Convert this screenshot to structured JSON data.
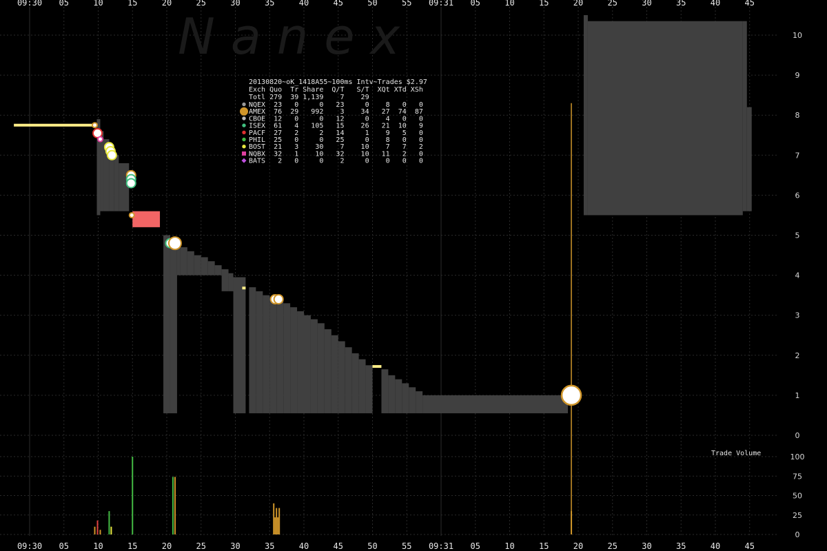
{
  "watermark": "N  a  n  e  x",
  "colors": {
    "background": "#000000",
    "grid": "#2b2b2b",
    "bid_ask_fill": "#404040",
    "nbbo_highlight": "#f26565",
    "quote_line": "#ffee88",
    "trade_spike": "#d0962a",
    "volume_amex": "#d0962a"
  },
  "chart_data": {
    "type": "line",
    "title": "20130820~oK_1418A55~100ms Intv~Trades $2.97",
    "x_axis": {
      "tick_labels": [
        "09:30",
        "05",
        "10",
        "15",
        "20",
        "25",
        "30",
        "35",
        "40",
        "45",
        "50",
        "55",
        "09:31",
        "05",
        "10",
        "15",
        "20",
        "25",
        "30",
        "35",
        "40",
        "45"
      ],
      "tick_seconds": [
        0,
        5,
        10,
        15,
        20,
        25,
        30,
        35,
        40,
        45,
        50,
        55,
        60,
        65,
        70,
        75,
        80,
        85,
        90,
        95,
        100,
        105
      ]
    },
    "price_axis": {
      "ticks": [
        0,
        1,
        2,
        3,
        4,
        5,
        6,
        7,
        8,
        9,
        10
      ],
      "range": [
        -0.45,
        11
      ]
    },
    "volume_axis": {
      "title": "Trade Volume",
      "ticks": [
        0,
        25,
        50,
        75,
        100
      ],
      "range": [
        0,
        100
      ]
    },
    "grid": true,
    "bid_ask_spread": [
      {
        "t0": 9.8,
        "t1": 10.3,
        "low": 5.5,
        "high": 7.9
      },
      {
        "t0": 10.3,
        "t1": 10.8,
        "low": 5.6,
        "high": 7.6
      },
      {
        "t0": 10.8,
        "t1": 11.6,
        "low": 5.6,
        "high": 7.4
      },
      {
        "t0": 11.6,
        "t1": 12.3,
        "low": 5.6,
        "high": 7.2
      },
      {
        "t0": 12.3,
        "t1": 13.0,
        "low": 5.6,
        "high": 7.0
      },
      {
        "t0": 13.0,
        "t1": 14.5,
        "low": 5.6,
        "high": 6.8
      },
      {
        "t0": 19.5,
        "t1": 20.5,
        "low": 0.55,
        "high": 5.0
      },
      {
        "t0": 20.5,
        "t1": 21.5,
        "low": 0.55,
        "high": 4.85
      },
      {
        "t0": 21.5,
        "t1": 22.0,
        "low": 4.0,
        "high": 4.8
      },
      {
        "t0": 22.0,
        "t1": 23.0,
        "low": 4.0,
        "high": 4.7
      },
      {
        "t0": 23.0,
        "t1": 24.0,
        "low": 4.0,
        "high": 4.6
      },
      {
        "t0": 24.0,
        "t1": 25.0,
        "low": 4.0,
        "high": 4.5
      },
      {
        "t0": 25.0,
        "t1": 26.0,
        "low": 4.0,
        "high": 4.45
      },
      {
        "t0": 26.0,
        "t1": 27.0,
        "low": 4.0,
        "high": 4.35
      },
      {
        "t0": 27.0,
        "t1": 28.0,
        "low": 4.0,
        "high": 4.25
      },
      {
        "t0": 28.0,
        "t1": 29.0,
        "low": 3.6,
        "high": 4.15
      },
      {
        "t0": 29.0,
        "t1": 29.7,
        "low": 3.6,
        "high": 4.05
      },
      {
        "t0": 29.7,
        "t1": 31.5,
        "low": 0.55,
        "high": 3.95
      },
      {
        "t0": 32.0,
        "t1": 33.0,
        "low": 0.55,
        "high": 3.7
      },
      {
        "t0": 33.0,
        "t1": 34.0,
        "low": 0.55,
        "high": 3.6
      },
      {
        "t0": 34.0,
        "t1": 35.0,
        "low": 0.55,
        "high": 3.5
      },
      {
        "t0": 35.0,
        "t1": 36.0,
        "low": 0.55,
        "high": 3.45
      },
      {
        "t0": 36.0,
        "t1": 37.0,
        "low": 0.55,
        "high": 3.4
      },
      {
        "t0": 37.0,
        "t1": 38.0,
        "low": 0.55,
        "high": 3.3
      },
      {
        "t0": 38.0,
        "t1": 39.0,
        "low": 0.55,
        "high": 3.2
      },
      {
        "t0": 39.0,
        "t1": 40.0,
        "low": 0.55,
        "high": 3.1
      },
      {
        "t0": 40.0,
        "t1": 41.0,
        "low": 0.55,
        "high": 3.0
      },
      {
        "t0": 41.0,
        "t1": 42.0,
        "low": 0.55,
        "high": 2.9
      },
      {
        "t0": 42.0,
        "t1": 43.0,
        "low": 0.55,
        "high": 2.8
      },
      {
        "t0": 43.0,
        "t1": 44.0,
        "low": 0.55,
        "high": 2.65
      },
      {
        "t0": 44.0,
        "t1": 45.0,
        "low": 0.55,
        "high": 2.5
      },
      {
        "t0": 45.0,
        "t1": 46.0,
        "low": 0.55,
        "high": 2.35
      },
      {
        "t0": 46.0,
        "t1": 47.0,
        "low": 0.55,
        "high": 2.2
      },
      {
        "t0": 47.0,
        "t1": 48.0,
        "low": 0.55,
        "high": 2.05
      },
      {
        "t0": 48.0,
        "t1": 49.0,
        "low": 0.55,
        "high": 1.9
      },
      {
        "t0": 49.0,
        "t1": 50.0,
        "low": 0.55,
        "high": 1.75
      },
      {
        "t0": 51.3,
        "t1": 52.3,
        "low": 0.55,
        "high": 1.65
      },
      {
        "t0": 52.3,
        "t1": 53.3,
        "low": 0.55,
        "high": 1.5
      },
      {
        "t0": 53.3,
        "t1": 54.3,
        "low": 0.55,
        "high": 1.4
      },
      {
        "t0": 54.3,
        "t1": 55.3,
        "low": 0.55,
        "high": 1.3
      },
      {
        "t0": 55.3,
        "t1": 56.3,
        "low": 0.55,
        "high": 1.2
      },
      {
        "t0": 56.3,
        "t1": 57.3,
        "low": 0.55,
        "high": 1.1
      },
      {
        "t0": 57.3,
        "t1": 78.5,
        "low": 0.55,
        "high": 1.0
      },
      {
        "t0": 80.8,
        "t1": 81.4,
        "low": 5.5,
        "high": 10.5
      },
      {
        "t0": 81.4,
        "t1": 104.0,
        "low": 5.5,
        "high": 10.35
      },
      {
        "t0": 104.0,
        "t1": 104.6,
        "low": 5.6,
        "high": 10.35
      },
      {
        "t0": 104.6,
        "t1": 105.3,
        "low": 5.6,
        "high": 8.2
      }
    ],
    "nbbo_highlight": [
      {
        "t0": 15.0,
        "t1": 19.0,
        "low": 5.2,
        "high": 5.6
      }
    ],
    "quote_segments": [
      {
        "t0": -2.3,
        "t1": 9.6,
        "price": 7.75
      },
      {
        "t0": 31.0,
        "t1": 31.5,
        "price": 3.68
      },
      {
        "t0": 50.0,
        "t1": 51.3,
        "price": 1.72
      }
    ],
    "trade_spike": {
      "t": 79.0,
      "low": 0.0,
      "high": 8.3
    },
    "trades": [
      {
        "t": 9.5,
        "price": 7.75,
        "size": "s",
        "exchange": "AMEX"
      },
      {
        "t": 9.9,
        "price": 7.55,
        "size": "m",
        "exchange": "PACF"
      },
      {
        "t": 10.3,
        "price": 7.4,
        "size": "s",
        "exchange": "NQBX"
      },
      {
        "t": 11.6,
        "price": 7.2,
        "size": "m",
        "exchange": "BOST"
      },
      {
        "t": 11.8,
        "price": 7.1,
        "size": "m",
        "exchange": "BOST"
      },
      {
        "t": 12.0,
        "price": 7.0,
        "size": "m",
        "exchange": "BOST"
      },
      {
        "t": 14.8,
        "price": 6.5,
        "size": "m",
        "exchange": "AMEX"
      },
      {
        "t": 14.8,
        "price": 6.4,
        "size": "m",
        "exchange": "ISEX"
      },
      {
        "t": 14.8,
        "price": 6.3,
        "size": "m",
        "exchange": "ISEX"
      },
      {
        "t": 14.9,
        "price": 5.5,
        "size": "s",
        "exchange": "AMEX"
      },
      {
        "t": 20.5,
        "price": 4.8,
        "size": "m",
        "exchange": "ISEX"
      },
      {
        "t": 21.2,
        "price": 4.8,
        "size": "l",
        "exchange": "AMEX"
      },
      {
        "t": 35.8,
        "price": 3.4,
        "size": "m",
        "exchange": "AMEX"
      },
      {
        "t": 36.3,
        "price": 3.4,
        "size": "m",
        "exchange": "AMEX"
      },
      {
        "t": 79.0,
        "price": 1.0,
        "size": "xl",
        "exchange": "AMEX"
      }
    ],
    "volume_bars": [
      {
        "t": 9.5,
        "value": 10,
        "color": "#d0962a"
      },
      {
        "t": 9.9,
        "value": 18,
        "color": "#e04040"
      },
      {
        "t": 10.3,
        "value": 6,
        "color": "#d0962a"
      },
      {
        "t": 11.6,
        "value": 30,
        "color": "#44bb44"
      },
      {
        "t": 11.9,
        "value": 10,
        "color": "#e8e840"
      },
      {
        "t": 15.0,
        "value": 100,
        "color": "#44bb44"
      },
      {
        "t": 20.9,
        "value": 74,
        "color": "#44bb44"
      },
      {
        "t": 21.2,
        "value": 74,
        "color": "#d0962a"
      },
      {
        "t": 35.6,
        "value": 40,
        "color": "#d0962a"
      },
      {
        "t": 35.8,
        "value": 22,
        "color": "#d0962a"
      },
      {
        "t": 36.0,
        "value": 34,
        "color": "#d0962a"
      },
      {
        "t": 36.2,
        "value": 22,
        "color": "#d0962a"
      },
      {
        "t": 36.4,
        "value": 34,
        "color": "#d0962a"
      },
      {
        "t": 79.0,
        "value": 30,
        "color": "#d0962a"
      }
    ],
    "legend_table": {
      "header": "Exch Quo  Tr Share  Q/T   S/T  XQt XTd XSh",
      "totals": "Totl 279  39 1,139    7    29",
      "rows": [
        {
          "symbol": "circle",
          "color": "#9a9a9a",
          "exchange": "NQEX",
          "text": "NQEX  23   0     0   23     0    8   0   0"
        },
        {
          "symbol": "big-circle",
          "color": "#d0962a",
          "exchange": "AMEX",
          "text": "AMEX  76  29   992    3    34   27  74  87"
        },
        {
          "symbol": "circle",
          "color": "#bbbbbb",
          "exchange": "CBOE",
          "text": "CBOE  12   0     0   12     0    4   0   0"
        },
        {
          "symbol": "circle",
          "color": "#40c080",
          "exchange": "ISEX",
          "text": "ISEX  61   4   105   15    26   21  10   9"
        },
        {
          "symbol": "circle",
          "color": "#e03030",
          "exchange": "PACF",
          "text": "PACF  27   2     2   14     1    9   5   0"
        },
        {
          "symbol": "circle",
          "color": "#44bb44",
          "exchange": "PHIL",
          "text": "PHIL  25   0     0   25     0    8   0   0"
        },
        {
          "symbol": "circle",
          "color": "#e8e840",
          "exchange": "BOST",
          "text": "BOST  21   3    30    7    10    7   7   2"
        },
        {
          "symbol": "square",
          "color": "#e040a0",
          "exchange": "NQBX",
          "text": "NQBX  32   1    10   32    10   11   2   0"
        },
        {
          "symbol": "diamond",
          "color": "#c050e0",
          "exchange": "BATS",
          "text": "BATS   2   0     0    2     0    0   0   0"
        }
      ]
    }
  }
}
